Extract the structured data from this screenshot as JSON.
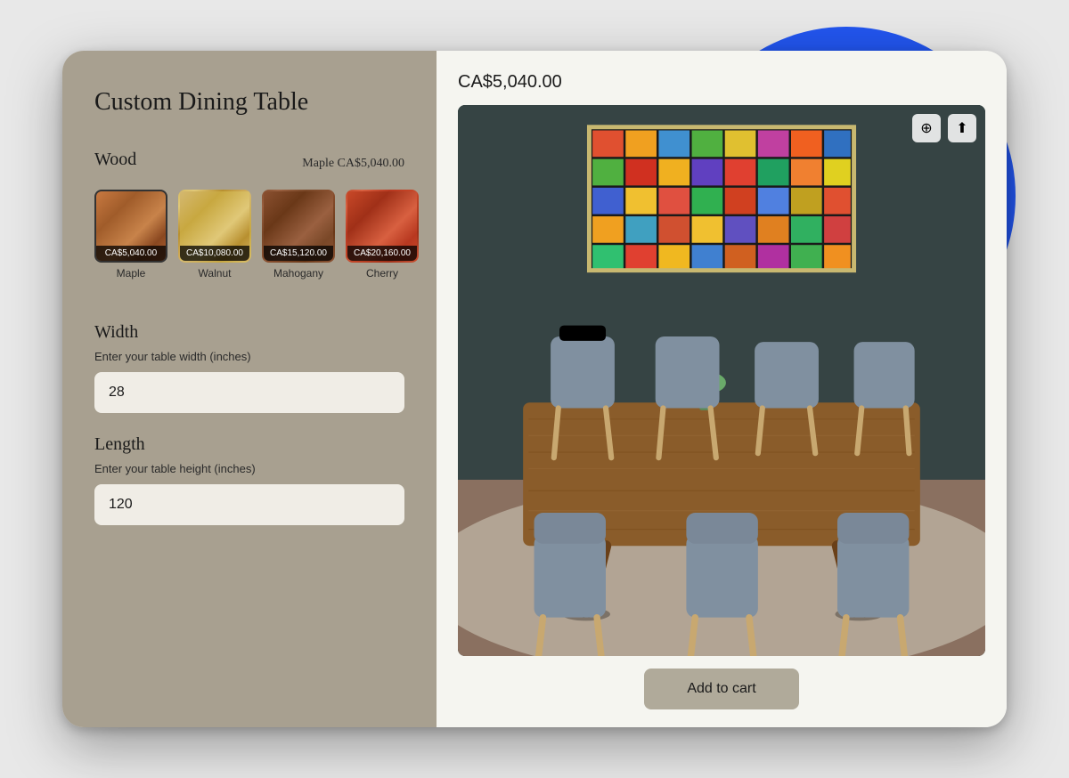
{
  "page": {
    "background_circle_color": "#2255ee"
  },
  "product": {
    "title": "Custom Dining Table",
    "price": "CA$5,040.00"
  },
  "wood_section": {
    "label": "Wood",
    "selected_info": "Maple  CA$5,040.00",
    "options": [
      {
        "id": "maple",
        "name": "Maple",
        "price": "CA$5,040.00",
        "selected": true
      },
      {
        "id": "walnut",
        "name": "Walnut",
        "price": "CA$10,080.00",
        "selected": false
      },
      {
        "id": "mahogany",
        "name": "Mahogany",
        "price": "CA$15,120.00",
        "selected": false
      },
      {
        "id": "cherry",
        "name": "Cherry",
        "price": "CA$20,160.00",
        "selected": false
      }
    ]
  },
  "width_section": {
    "label": "Width",
    "input_label": "Enter your table width (inches)",
    "value": "28"
  },
  "length_section": {
    "label": "Length",
    "input_label": "Enter your table height (inches)",
    "value": "120"
  },
  "toolbar": {
    "zoom_icon": "⊕",
    "share_icon": "⬆"
  },
  "cart": {
    "button_label": "Add to cart"
  }
}
